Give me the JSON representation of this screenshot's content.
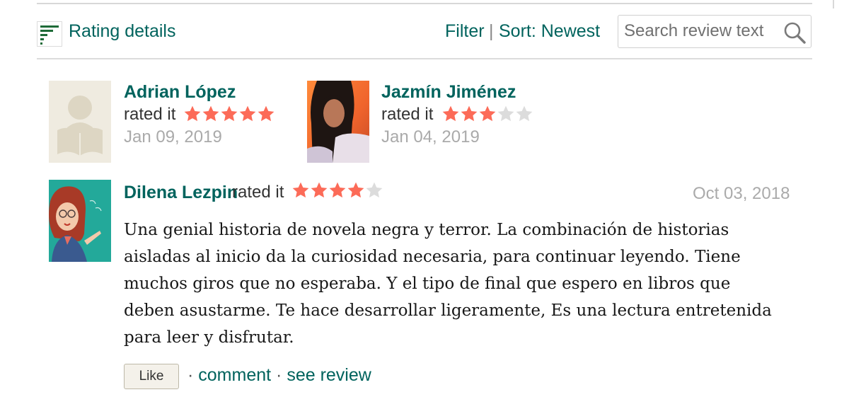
{
  "toolbar": {
    "rating_details_label": "Rating details",
    "filter_label": "Filter",
    "separator": "|",
    "sort_label": "Sort: Newest",
    "search_placeholder": "Search review text"
  },
  "reviews_compact": [
    {
      "name": "Adrian López",
      "rated_text": "rated it",
      "rating": 5,
      "max_rating": 5,
      "date": "Jan 09, 2019"
    },
    {
      "name": "Jazmín Jiménez",
      "rated_text": "rated it",
      "rating": 3,
      "max_rating": 5,
      "date": "Jan 04, 2019"
    }
  ],
  "review_full": {
    "name": "Dilena Lezpin",
    "rated_text": "rated it",
    "rating": 4,
    "max_rating": 5,
    "date": "Oct 03, 2018",
    "text": "Una genial historia de novela negra y terror. La combinación de historias aisladas al inicio da la curiosidad necesaria, para continuar leyendo. Tiene muchos giros que no esperaba. Y el tipo de final que espero en libros que deben asustarme. Te hace desarrollar ligeramente, Es una lectura entretenida para leer y disfrutar.",
    "like_label": "Like",
    "action_separator": "·",
    "comment_label": "comment",
    "see_review_label": "see review"
  },
  "colors": {
    "link": "#00635d",
    "star_filled": "#fc6b58",
    "star_empty": "#dcdcdc",
    "date": "#aaaaaa"
  },
  "icons": [
    "rating-details-icon",
    "search-icon",
    "star-icon"
  ]
}
